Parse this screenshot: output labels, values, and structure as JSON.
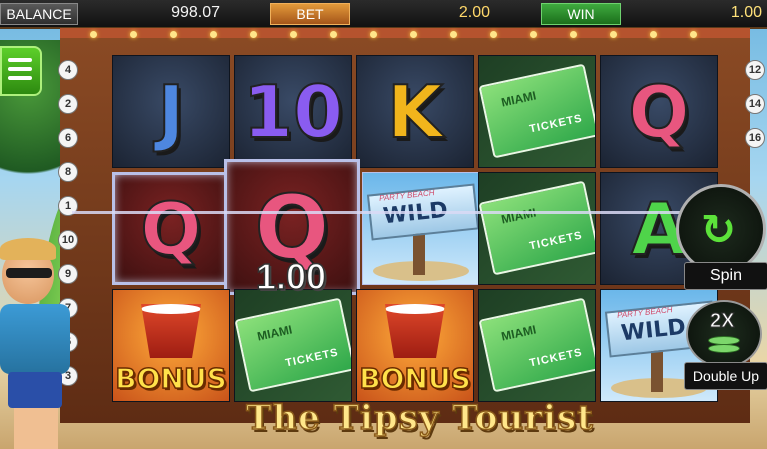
{
  "header": {
    "balance_label": "BALANCE",
    "balance_value": "998.07",
    "bet_label": "BET",
    "bet_value": "2.00",
    "win_label": "WIN",
    "win_value": "1.00"
  },
  "menu": {
    "icon": "hamburger-menu-icon"
  },
  "paylines_left": [
    "4",
    "2",
    "6",
    "8",
    "1",
    "10",
    "9",
    "7",
    "5",
    "3"
  ],
  "paylines_right": [
    "12",
    "14",
    "16"
  ],
  "reels": {
    "row1": [
      "J",
      "10",
      "K",
      "Tickets",
      "Q"
    ],
    "row2": [
      "Q",
      "Q",
      "Wild",
      "Tickets",
      "A"
    ],
    "row3": [
      "Bonus",
      "Tickets",
      "Bonus",
      "Tickets",
      "Wild"
    ]
  },
  "symbols": {
    "bonus_text": "BONUS",
    "wild_text": "WILD",
    "wild_small": "PARTY BEACH",
    "ticket_text": "TICKETS",
    "ticket_brand": "MIAMI"
  },
  "win_amount": "1.00",
  "controls": {
    "spin_label": "Spin",
    "double_label": "Double Up",
    "double_multiplier": "2X"
  },
  "logo_text": "The Tipsy Tourist",
  "colors": {
    "win_green": "#3faa3f",
    "bet_orange": "#e39a3a",
    "spin_arrow": "#5ce23a"
  }
}
